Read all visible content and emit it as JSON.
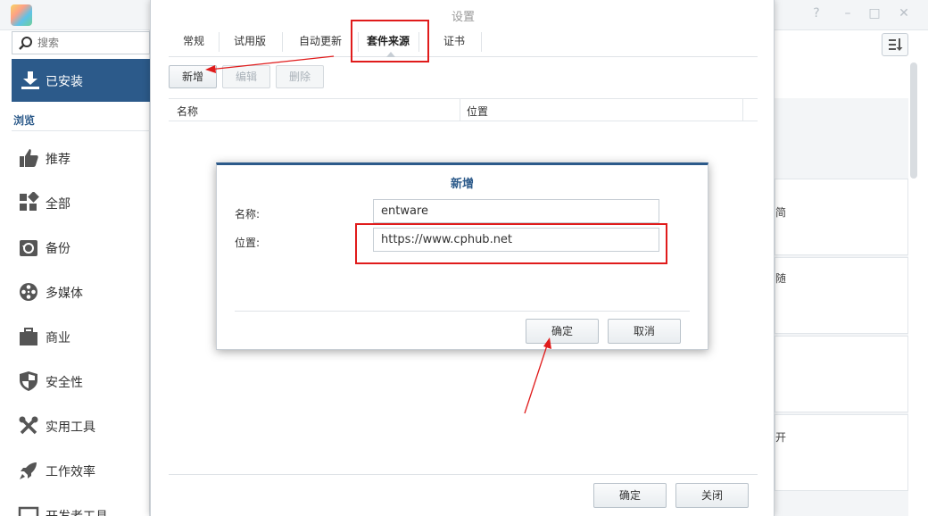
{
  "background": {
    "search": {
      "placeholder": "搜索"
    },
    "installed": {
      "label": "已安装"
    },
    "browse": {
      "label": "浏览"
    },
    "nav_items": [
      {
        "label": "推荐",
        "icon": "thumbs-up-icon"
      },
      {
        "label": "全部",
        "icon": "grid-icon"
      },
      {
        "label": "备份",
        "icon": "backup-icon"
      },
      {
        "label": "多媒体",
        "icon": "film-reel-icon"
      },
      {
        "label": "商业",
        "icon": "briefcase-icon"
      },
      {
        "label": "安全性",
        "icon": "shield-icon"
      },
      {
        "label": "实用工具",
        "icon": "wrench-icon"
      },
      {
        "label": "工作效率",
        "icon": "rocket-icon"
      },
      {
        "label": "开发者工具",
        "icon": "terminal-icon"
      }
    ],
    "card_fragments": [
      "简",
      "随",
      "开"
    ]
  },
  "settings": {
    "title": "设置",
    "tabs": [
      {
        "label": "常规"
      },
      {
        "label": "试用版"
      },
      {
        "label": "自动更新"
      },
      {
        "label": "套件来源"
      },
      {
        "label": "证书"
      }
    ],
    "toolbar": {
      "add": "新增",
      "edit": "编辑",
      "delete": "删除"
    },
    "columns": {
      "name": "名称",
      "location": "位置"
    },
    "footer": {
      "ok": "确定",
      "close": "关闭"
    }
  },
  "dialog": {
    "title": "新增",
    "name_label": "名称:",
    "name_value": "entware",
    "location_label": "位置:",
    "location_value": "https://www.cphub.net",
    "ok": "确定",
    "cancel": "取消"
  },
  "colors": {
    "accent": "#2c5a8a",
    "annotation": "#e01b1b"
  }
}
